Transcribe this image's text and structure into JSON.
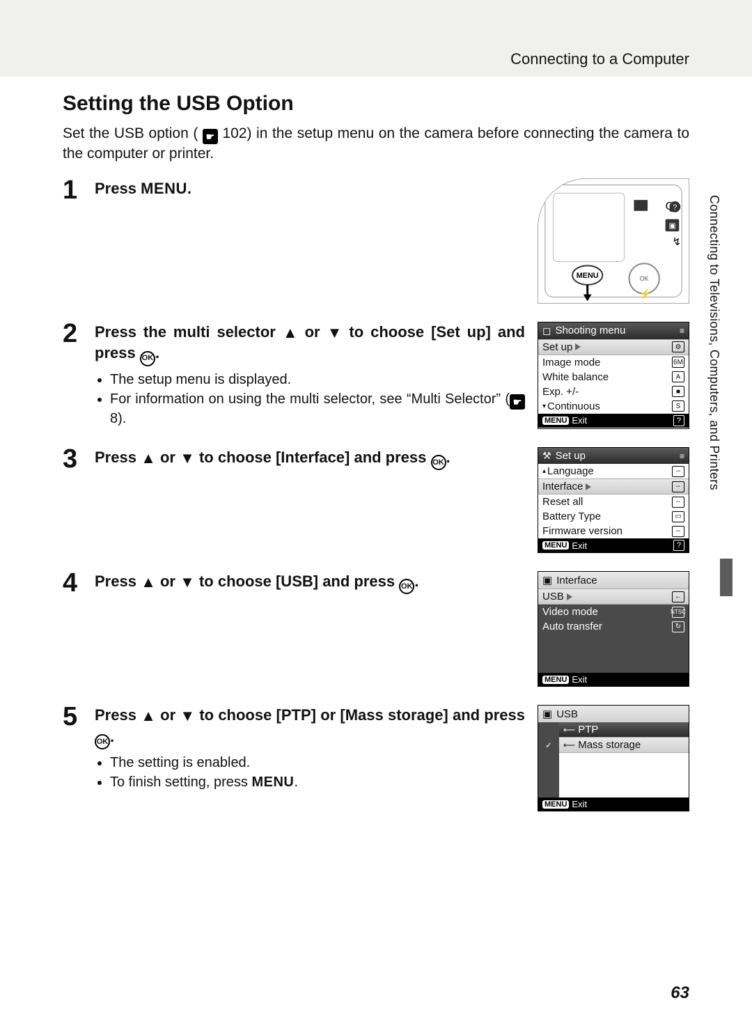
{
  "breadcrumb": "Connecting to a Computer",
  "title": "Setting the USB Option",
  "intro_a": "Set the USB option (",
  "intro_ref": "102",
  "intro_b": ") in the setup menu on the camera before connecting the camera to the computer or printer.",
  "side_label": "Connecting to Televisions, Computers, and Printers",
  "page_number": "63",
  "steps": {
    "s1": {
      "num": "1",
      "head_a": "Press ",
      "head_b": "MENU",
      "head_c": "."
    },
    "s2": {
      "num": "2",
      "head_a": "Press the multi selector ",
      "head_b": " or ",
      "head_c": " to choose [Set up] and press ",
      "head_d": ".",
      "b1": "The setup menu is displayed.",
      "b2_a": "For information on using the multi selector, see “Multi Selector” (",
      "b2_ref": "8",
      "b2_b": ")."
    },
    "s3": {
      "num": "3",
      "head_a": "Press ",
      "head_b": " or ",
      "head_c": " to choose [Interface] and press ",
      "head_d": "."
    },
    "s4": {
      "num": "4",
      "head_a": "Press ",
      "head_b": " or ",
      "head_c": " to choose [USB] and press ",
      "head_d": "."
    },
    "s5": {
      "num": "5",
      "head_a": "Press ",
      "head_b": " or ",
      "head_c": " to choose [PTP] or [Mass storage] and press ",
      "head_d": ".",
      "b1": "The setting is enabled.",
      "b2_a": "To finish setting, press ",
      "b2_b": "MENU",
      "b2_c": "."
    }
  },
  "screens": {
    "shooting": {
      "title": "Shooting menu",
      "items": {
        "setup": "Set up",
        "image": "Image mode",
        "wb": "White balance",
        "exp": "Exp. +/-",
        "cont": "Continuous"
      },
      "icons": {
        "setup": "⚙",
        "image": "6M",
        "wb": "A",
        "exp": "■",
        "cont": "S"
      },
      "exit": "Exit"
    },
    "setup": {
      "title": "Set up",
      "items": {
        "lang": "Language",
        "iface": "Interface",
        "reset": "Reset all",
        "batt": "Battery Type",
        "fw": "Firmware version"
      },
      "exit": "Exit"
    },
    "interface": {
      "title": "Interface",
      "items": {
        "usb": "USB",
        "video": "Video mode",
        "auto": "Auto transfer"
      },
      "icons": {
        "usb": "←",
        "video": "NTSC",
        "auto": "↻"
      },
      "exit": "Exit"
    },
    "usb": {
      "title": "USB",
      "items": {
        "ptp": "PTP",
        "mass": "Mass storage"
      },
      "exit": "Exit"
    }
  },
  "glyphs": {
    "ok": "OK",
    "menu_badge": "MENU",
    "help": "?",
    "hamburger": "≡",
    "camera": "▣",
    "wrench": "⚒",
    "interface_icon": "▣",
    "usb_small": "←"
  }
}
